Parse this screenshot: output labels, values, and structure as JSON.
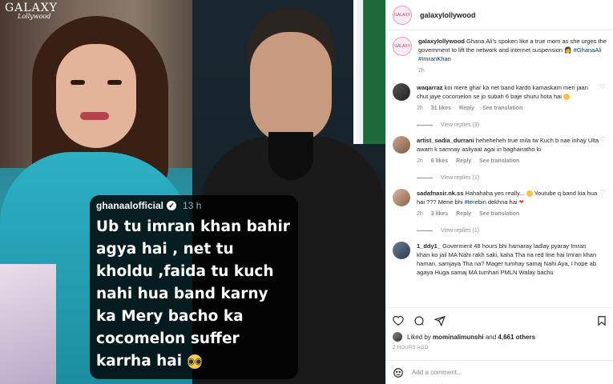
{
  "media": {
    "watermark": "GALAXY",
    "watermark_sub": "Lollywood",
    "story": {
      "username": "ghanaalofficial",
      "time": "13 h",
      "text": "Ub tu imran khan bahir agya hai , net tu kholdu ,faida tu kuch nahi hua band karny ka Mery bacho ka cocomelon suffer karrha hai",
      "emoji": "glasses-emoji"
    }
  },
  "post": {
    "username": "galaxylollywood",
    "avatar_text": "GALAXY"
  },
  "caption": {
    "username": "galaxylollywood",
    "text": "Ghana Ali's spoken like a true mom as she urges the government to lift the network and internet suspension",
    "hashtags": "#GhanaAli #ImranKhan",
    "age": "2h"
  },
  "comments": [
    {
      "username": "waqarraz",
      "text": "koi mere ghar ka net band kardo kamaskam meri jaan chut jaye cocomelon se jo subah 6 baje shuru hota hai",
      "age": "2h",
      "likes": "31 likes",
      "reply": "Reply",
      "translation": "See translation",
      "replies": "View replies (3)"
    },
    {
      "username": "artist_sadia_durrani",
      "text": "heheheheh true mila tw Kuch b nae inhay Ulta awam k samnay asliyaat agai in baghairatho ki",
      "age": "2h",
      "likes": "6 likes",
      "reply": "Reply",
      "translation": "See translation",
      "replies": "View replies (1)"
    },
    {
      "username": "sadafnasir.nk.ss",
      "text_pre": "Hahahaha yes really...",
      "text_mid": "Youtube q band kia hua hai ??? Mene bhi",
      "hashtag": "#terebin",
      "text_post": "dekhna hai",
      "age": "2h",
      "likes": "3 likes",
      "reply": "Reply",
      "translation": "See translation",
      "replies": "View replies (1)"
    },
    {
      "username": "1_ddy1_",
      "text": "Goverment 48 hours bhi hamaray ladlay pyaray Imran khan ko jail MA Nahi rakh saki, kaha Tha na red line hai Imran khan hamari, samjaya Tha na? Mager tumhay samaj Nahi Aya, I hope ab agaya Huga samaj MA tumhari PMLN Walay bachu"
    }
  ],
  "actions": {
    "liked_by_prefix": "Liked by",
    "liked_by_user": "mominalimunshi",
    "liked_by_and": "and",
    "others": "4,661 others",
    "timestamp": "2 HOURS AGO"
  },
  "add_comment": {
    "placeholder": "Add a comment..."
  }
}
